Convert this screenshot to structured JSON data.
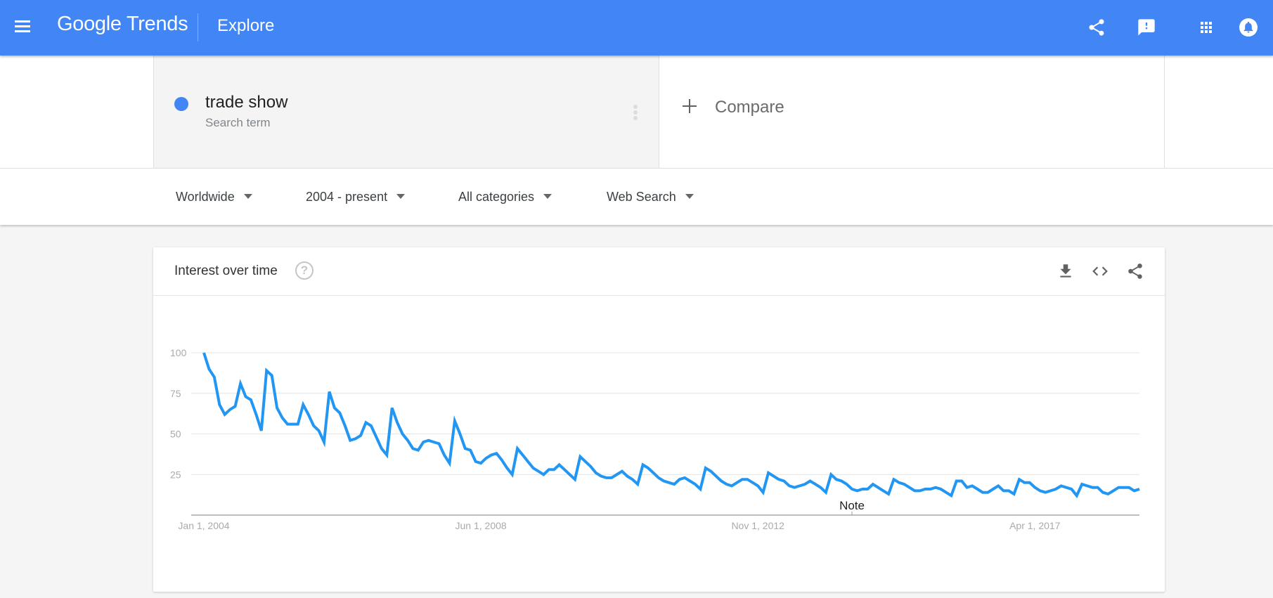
{
  "header": {
    "app_name": "Google Trends",
    "page_name": "Explore",
    "brand_color": "#4285f4",
    "icons": [
      "share-icon",
      "feedback-icon",
      "apps-icon",
      "notifications-icon"
    ]
  },
  "search_terms": [
    {
      "name": "trade show",
      "type": "Search term",
      "color": "#4285f4"
    }
  ],
  "compare": {
    "label": "Compare"
  },
  "filters": [
    {
      "label": "Worldwide"
    },
    {
      "label": "2004 - present"
    },
    {
      "label": "All categories"
    },
    {
      "label": "Web Search"
    }
  ],
  "interest_card": {
    "title": "Interest over time",
    "help_symbol": "?",
    "actions": [
      "download-icon",
      "embed-icon",
      "share-icon"
    ]
  },
  "chart_data": {
    "type": "line",
    "title": "Interest over time",
    "xlabel": "",
    "ylabel": "",
    "series_color": "#2196f3",
    "ylim": [
      0,
      100
    ],
    "yticks": [
      25,
      50,
      75,
      100
    ],
    "grid": true,
    "x_start": "Jan 2004",
    "x_interval": "monthly",
    "xtick_labels": [
      {
        "label": "Jan 1, 2004",
        "index": 0
      },
      {
        "label": "Jun 1, 2008",
        "index": 53
      },
      {
        "label": "Nov 1, 2012",
        "index": 106
      },
      {
        "label": "Apr 1, 2017",
        "index": 159
      }
    ],
    "annotation": {
      "label": "Note",
      "index": 124
    },
    "series": [
      {
        "name": "trade show",
        "values": [
          100,
          90,
          85,
          68,
          62,
          65,
          67,
          81,
          73,
          71,
          62,
          52,
          89,
          86,
          66,
          60,
          56,
          56,
          56,
          68,
          62,
          55,
          52,
          45,
          76,
          66,
          63,
          55,
          46,
          47,
          49,
          57,
          55,
          48,
          41,
          37,
          66,
          57,
          50,
          46,
          41,
          40,
          45,
          46,
          45,
          44,
          37,
          32,
          58,
          50,
          41,
          40,
          33,
          32,
          35,
          37,
          38,
          34,
          29,
          25,
          41,
          37,
          33,
          29,
          27,
          25,
          28,
          28,
          31,
          28,
          25,
          22,
          36,
          33,
          30,
          26,
          24,
          23,
          23,
          25,
          27,
          24,
          22,
          19,
          31,
          29,
          26,
          23,
          21,
          20,
          19,
          22,
          23,
          21,
          19,
          16,
          29,
          27,
          24,
          21,
          19,
          18,
          20,
          22,
          22,
          20,
          18,
          14,
          26,
          24,
          22,
          21,
          18,
          17,
          18,
          19,
          21,
          19,
          17,
          14,
          25,
          22,
          21,
          19,
          16,
          15,
          16,
          16,
          19,
          17,
          15,
          13,
          22,
          20,
          19,
          17,
          15,
          15,
          16,
          16,
          17,
          16,
          14,
          12,
          21,
          21,
          17,
          18,
          16,
          14,
          14,
          16,
          18,
          15,
          15,
          13,
          22,
          20,
          20,
          17,
          15,
          14,
          15,
          16,
          18,
          17,
          16,
          12,
          19,
          18,
          17,
          17,
          14,
          13,
          15,
          17,
          17,
          17,
          15,
          16
        ]
      }
    ]
  }
}
